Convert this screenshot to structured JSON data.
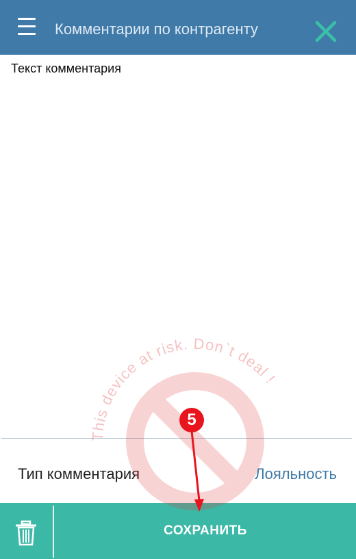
{
  "header": {
    "title": "Комментарии по контрагенту",
    "menu_icon": "hamburger-menu-icon",
    "close_icon": "close-x-icon",
    "bg_color": "#3f7aa8",
    "close_color": "#3bc0a7"
  },
  "comment": {
    "label": "Текст комментария",
    "value": ""
  },
  "comment_type": {
    "label": "Тип комментария",
    "value": "Лояльность"
  },
  "bottom_bar": {
    "save_label": "СОХРАНИТЬ",
    "delete_icon": "trash-icon",
    "bg_color": "#3bb8a6"
  },
  "watermark": {
    "text": "This device at risk. Don`t deal !",
    "icon": "prohibited-sign-icon",
    "color": "#e23a3a"
  },
  "annotation": {
    "step_number": "5",
    "color": "#e8141e"
  }
}
